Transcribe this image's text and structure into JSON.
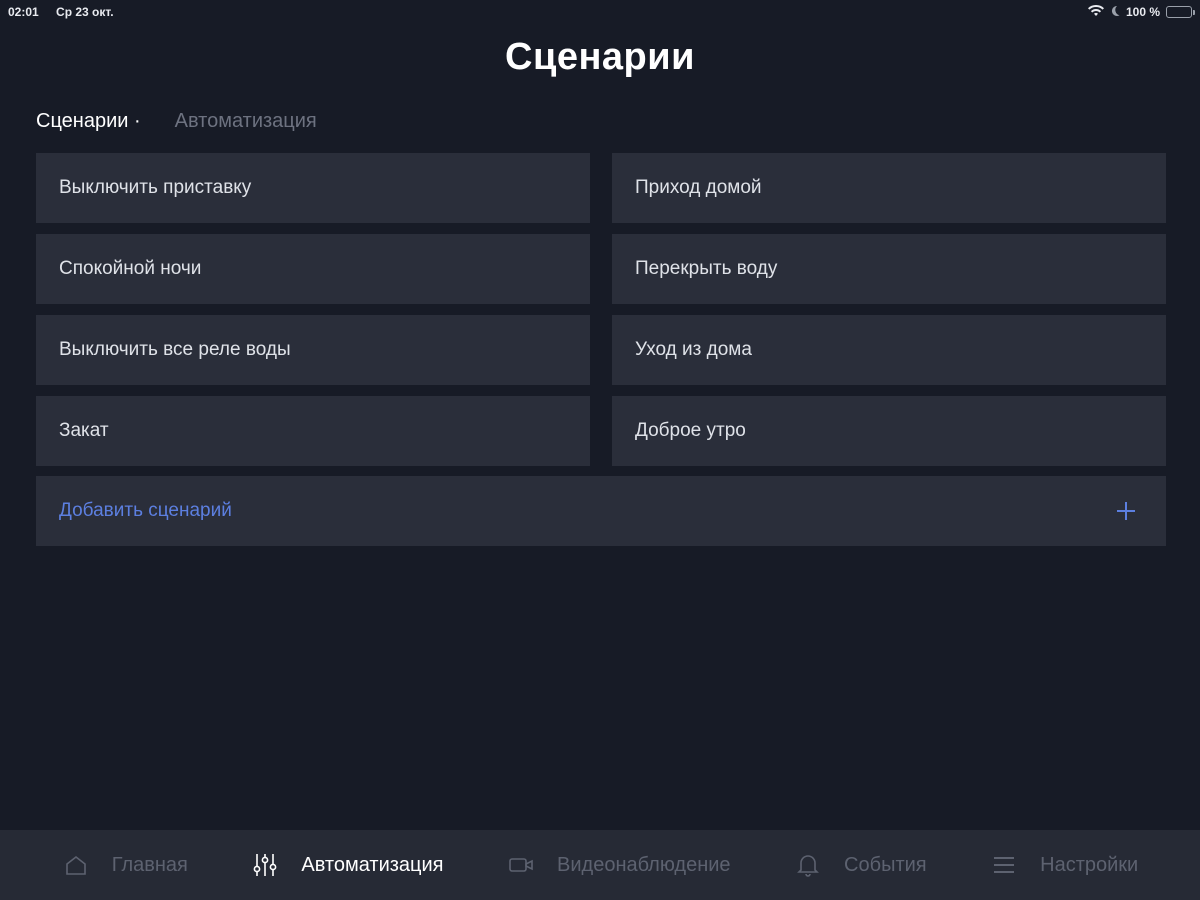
{
  "status_bar": {
    "time": "02:01",
    "date": "Ср 23 окт.",
    "battery": "100 %"
  },
  "page_title": "Сценарии",
  "tabs": [
    {
      "label": "Сценарии ·",
      "active": true
    },
    {
      "label": "Автоматизация",
      "active": false
    }
  ],
  "scenarios": [
    "Выключить приставку",
    "Приход домой",
    "Спокойной ночи",
    "Перекрыть воду",
    "Выключить все реле воды",
    "Уход из дома",
    "Закат",
    "Доброе утро"
  ],
  "add_scenario_label": "Добавить сценарий",
  "bottom_nav": [
    {
      "label": "Главная",
      "icon": "home-icon",
      "active": false
    },
    {
      "label": "Автоматизация",
      "icon": "sliders-icon",
      "active": true
    },
    {
      "label": "Видеонаблюдение",
      "icon": "camera-icon",
      "active": false
    },
    {
      "label": "События",
      "icon": "bell-icon",
      "active": false
    },
    {
      "label": "Настройки",
      "icon": "menu-icon",
      "active": false
    }
  ],
  "colors": {
    "background": "#171b26",
    "card": "#2a2e3a",
    "accent": "#5c7fe0",
    "nav_background": "#262a35"
  }
}
